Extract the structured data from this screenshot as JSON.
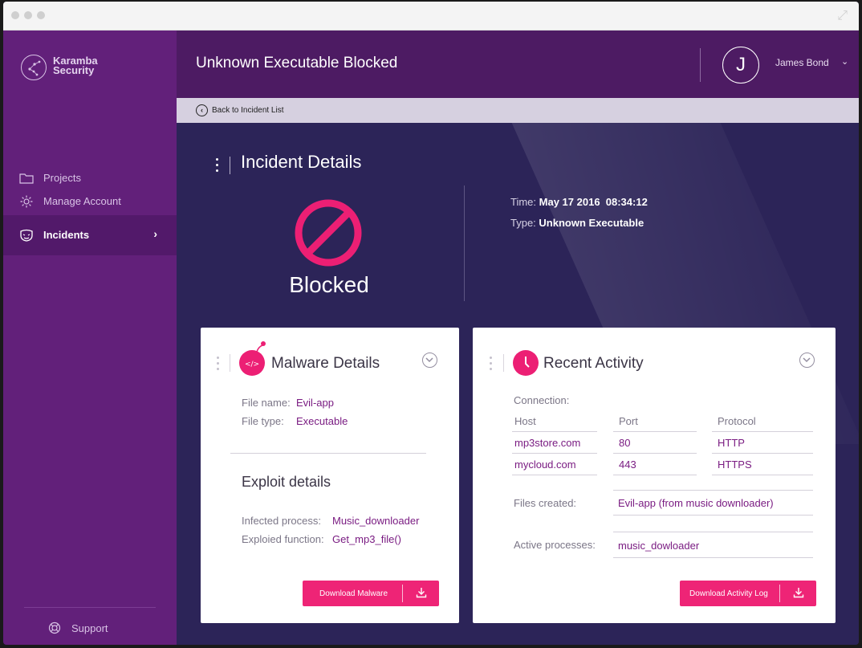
{
  "brand": {
    "line1": "Karamba",
    "line2": "Security"
  },
  "sidebar": {
    "items": [
      {
        "label": "Projects",
        "icon": "folder-icon"
      },
      {
        "label": "Manage Account",
        "icon": "gear-icon"
      },
      {
        "label": "Incidents",
        "icon": "mask-icon",
        "active": true
      }
    ],
    "support_label": "Support"
  },
  "header": {
    "title": "Unknown Executable Blocked",
    "avatar_initial": "J",
    "user_name": "James Bond"
  },
  "subbar": {
    "back_label": "Back to Incident List"
  },
  "incident": {
    "section_title": "Incident Details",
    "status": "Blocked",
    "time_label": "Time:",
    "time_value": "May 17 2016  08:34:12",
    "type_label": "Type:",
    "type_value": "Unknown Executable"
  },
  "malware": {
    "title": "Malware Details",
    "file_name_label": "File name:",
    "file_name_value": "Evil-app",
    "file_type_label": "File type:",
    "file_type_value": "Executable",
    "exploit_title": "Exploit details",
    "infected_label": "Infected process:",
    "infected_value": "Music_downloader",
    "exploited_label": "Exploied function:",
    "exploited_value": "Get_mp3_file()",
    "download_label": "Download Malware"
  },
  "activity": {
    "title": "Recent Activity",
    "connection_label": "Connection:",
    "headers": [
      "Host",
      "Port",
      "Protocol"
    ],
    "rows": [
      [
        "mp3store.com",
        "80",
        "HTTP"
      ],
      [
        "mycloud.com",
        "443",
        "HTTPS"
      ]
    ],
    "files_label": "Files created:",
    "files_value": "Evil-app (from music downloader)",
    "processes_label": "Active processes:",
    "processes_value": "music_dowloader",
    "download_label": "Download Activity Log"
  },
  "colors": {
    "sidebar": "#62207a",
    "header": "#4d1b63",
    "background": "#2c2458",
    "accent": "#ec1f74",
    "value": "#7a1c82"
  }
}
